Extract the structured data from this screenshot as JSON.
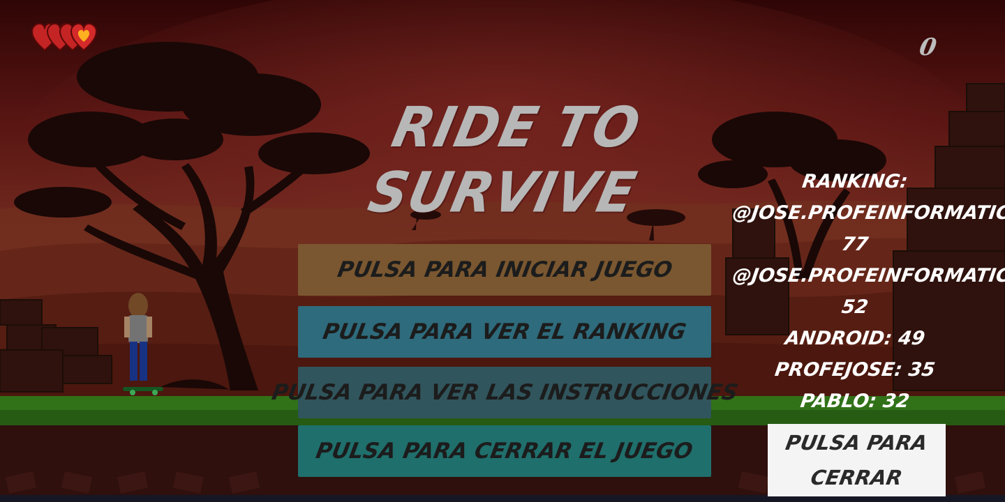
{
  "hud": {
    "lives": 4,
    "score": "0"
  },
  "title": "RIDE TO SURVIVE",
  "menu": {
    "start_label": "PULSA PARA INICIAR JUEGO",
    "ranking_label": "PULSA PARA VER EL RANKING",
    "instructions_label": "PULSA PARA VER LAS INSTRUCCIONES",
    "close_game_label": "PULSA PARA CERRAR EL JUEGO"
  },
  "ranking": {
    "heading": "RANKING:",
    "entries": [
      {
        "name": "@JOSE.PROFEINFORMATICA:",
        "score": "77"
      },
      {
        "name": "@JOSE.PROFEINFORMATICA:",
        "score": "52"
      },
      {
        "line": "ANDROID: 49"
      },
      {
        "line": "PROFEJOSE: 35"
      },
      {
        "line": "PABLO: 32"
      }
    ],
    "close_line1": "PULSA PARA",
    "close_line2": "CERRAR"
  },
  "colors": {
    "start_button": "#7a5730",
    "ranking_button": "#2e6b7c",
    "instructions_button": "#31555c",
    "close_game_button": "#1f6f6c",
    "sky": "#7a1f1c",
    "ground": "#3c8a1e"
  }
}
